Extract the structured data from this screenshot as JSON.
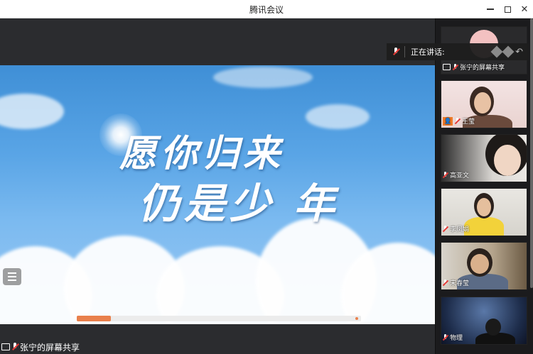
{
  "window": {
    "title": "腾讯会议"
  },
  "share": {
    "slogan_line1": "愿你归来",
    "slogan_line2": "仍是少 年",
    "progress": 0.12,
    "owner_label": "张宁的屏幕共享"
  },
  "speaking": {
    "label": "正在讲话:"
  },
  "participants": [
    {
      "name": "张宁的屏幕共享",
      "type": "screen"
    },
    {
      "name": "王莹",
      "type": "person"
    },
    {
      "name": "高亚文",
      "type": "person"
    },
    {
      "name": "李凤娟",
      "type": "person"
    },
    {
      "name": "宋春莹",
      "type": "person"
    },
    {
      "name": "物理",
      "type": "person"
    }
  ],
  "colors": {
    "accent": "#e9804c",
    "mic_muted": "#e53935",
    "avatar_badge": "#f07b2a"
  },
  "icons": [
    "minimize-icon",
    "maximize-icon",
    "close-icon",
    "mic-off-icon",
    "screen-share-icon",
    "list-icon"
  ]
}
